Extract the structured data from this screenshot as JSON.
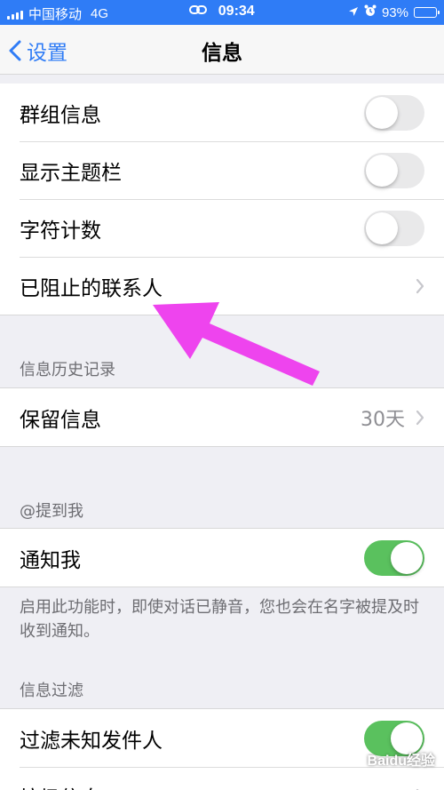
{
  "status_bar": {
    "carrier": "中国移动",
    "network": "4G",
    "time": "09:34",
    "battery": "93%",
    "battery_level": 0.93
  },
  "nav": {
    "back_label": "设置",
    "title": "信息"
  },
  "group_top": {
    "items": [
      {
        "label": "群组信息",
        "toggle_on": false
      },
      {
        "label": "显示主题栏",
        "toggle_on": false
      },
      {
        "label": "字符计数",
        "toggle_on": false
      },
      {
        "label": "已阻止的联系人"
      }
    ]
  },
  "history": {
    "header": "信息历史记录",
    "keep_label": "保留信息",
    "keep_value": "30天"
  },
  "mentions": {
    "header": "@提到我",
    "notify_label": "通知我",
    "notify_on": true,
    "footer": "启用此功能时，即使对话已静音，您也会在名字被提及时收到通知。"
  },
  "filtering": {
    "header": "信息过滤",
    "filter_label": "过滤未知发件人",
    "filter_on": true,
    "junk_label": "垃圾信息"
  },
  "colors": {
    "accent": "#2f7cf6",
    "toggle_on": "#5ac15e",
    "annotation_arrow": "#ee44ee"
  },
  "watermark": "Baidu经验"
}
